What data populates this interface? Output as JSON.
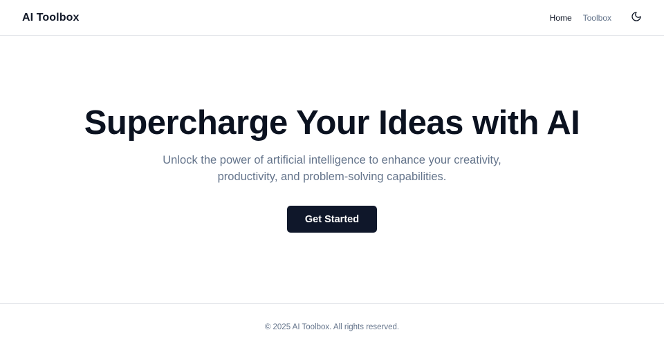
{
  "header": {
    "brand": "AI Toolbox",
    "nav": [
      {
        "label": "Home"
      },
      {
        "label": "Toolbox"
      }
    ],
    "theme_toggle_icon": "moon-icon"
  },
  "hero": {
    "title": "Supercharge Your Ideas with AI",
    "subtitle": "Unlock the power of artificial intelligence to enhance your creativity, productivity, and problem-solving capabilities.",
    "cta_label": "Get Started"
  },
  "footer": {
    "copyright": "© 2025 AI Toolbox. All rights reserved."
  },
  "colors": {
    "primary": "#0f172a",
    "muted_text": "#64748b",
    "border": "#e5e7eb",
    "background": "#ffffff"
  }
}
